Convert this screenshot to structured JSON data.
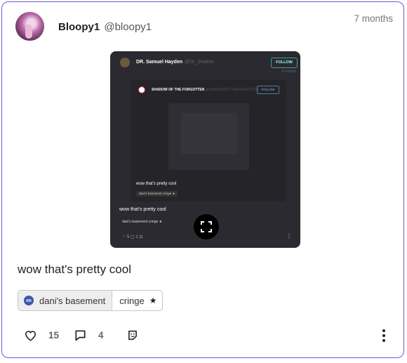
{
  "post": {
    "author_name": "Bloopy1",
    "author_handle": "@bloopy1",
    "time": "7 months",
    "text": "wow that's pretty cool",
    "tags": [
      "dani's basement",
      "cringe"
    ],
    "likes": "15",
    "comments": "4"
  },
  "embed": {
    "author_name": "DR. Samuel Hayden",
    "author_handle": "@Dr_Shakes",
    "follow_label": "FOLLOW",
    "time": "4 months",
    "inner_author": "SHADOW OF THE FORGOTTEN",
    "inner_handle": "@SHADOWOFTHEFORGOTTEN",
    "inner_follow": "FOLLOW",
    "inner_text": "wow that's pretty cool",
    "inner_tags": "dani's basement  cringe ★",
    "text": "wow that's pretty cool",
    "tags": "dani's basement   cringe ★",
    "actions": "♡ 5   ▢ 1   ⊡"
  }
}
